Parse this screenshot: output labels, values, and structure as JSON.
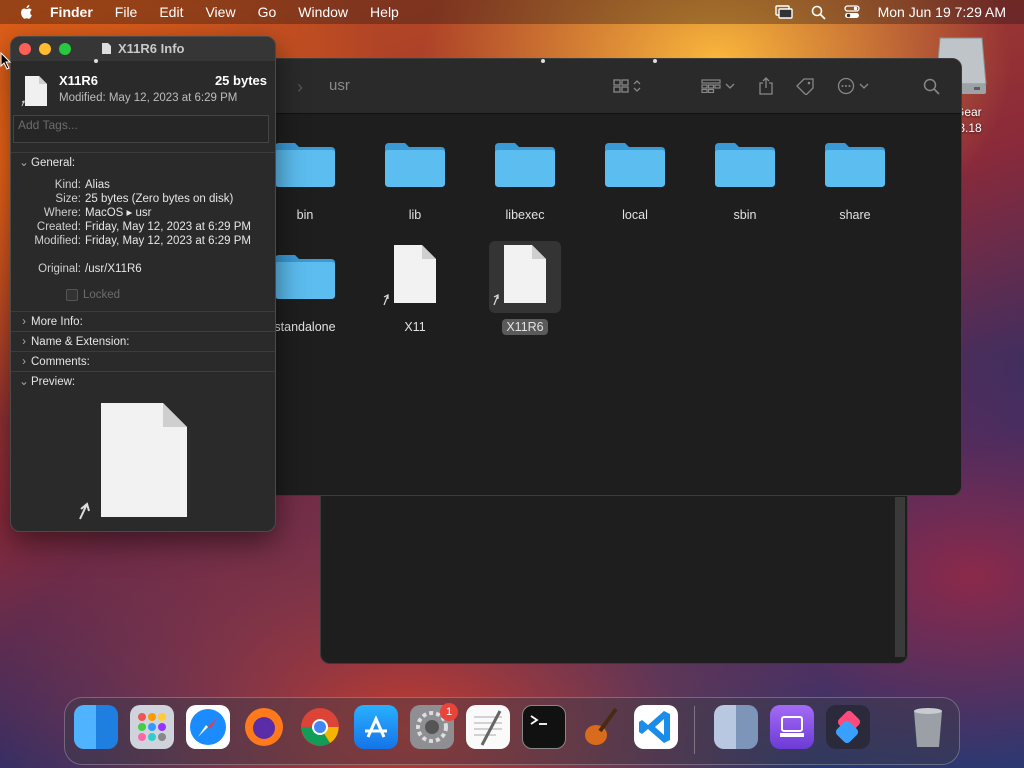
{
  "menubar": {
    "app": "Finder",
    "items": [
      "File",
      "Edit",
      "View",
      "Go",
      "Window",
      "Help"
    ],
    "clock": "Mon Jun 19  7:29 AM"
  },
  "desktop": {
    "drive_label_line1": "Gear",
    "drive_label_line2": ".3.18"
  },
  "finder": {
    "path": "usr",
    "items": [
      {
        "label": "bin",
        "kind": "folder"
      },
      {
        "label": "lib",
        "kind": "folder"
      },
      {
        "label": "libexec",
        "kind": "folder"
      },
      {
        "label": "local",
        "kind": "folder"
      },
      {
        "label": "sbin",
        "kind": "folder"
      },
      {
        "label": "share",
        "kind": "folder"
      },
      {
        "label": "standalone",
        "kind": "folder"
      },
      {
        "label": "X11",
        "kind": "alias"
      },
      {
        "label": "X11R6",
        "kind": "alias",
        "selected": true
      }
    ]
  },
  "info": {
    "window_title": "X11R6 Info",
    "name": "X11R6",
    "size": "25 bytes",
    "modified_header": "Modified: May 12, 2023 at 6:29 PM",
    "tags_placeholder": "Add Tags...",
    "general_label": "General:",
    "kind_k": "Kind:",
    "kind_v": "Alias",
    "size_k": "Size:",
    "size_v": "25 bytes (Zero bytes on disk)",
    "where_k": "Where:",
    "where_v": "MacOS ▸ usr",
    "created_k": "Created:",
    "created_v": "Friday, May 12, 2023 at 6:29 PM",
    "modified_k": "Modified:",
    "modified_v": "Friday, May 12, 2023 at 6:29 PM",
    "original_k": "Original:",
    "original_v": "/usr/X11R6",
    "locked_label": "Locked",
    "more_info": "More Info:",
    "name_ext": "Name & Extension:",
    "comments": "Comments:",
    "preview": "Preview:"
  },
  "dock": {
    "badge": "1",
    "apps": [
      "Finder",
      "Launchpad",
      "Safari",
      "Firefox",
      "Chrome",
      "App Store",
      "System Settings",
      "TextEdit",
      "Terminal",
      "GarageBand",
      "Visual Studio Code",
      "Finder",
      "Podcasts",
      "Shortcuts",
      "Trash"
    ]
  }
}
